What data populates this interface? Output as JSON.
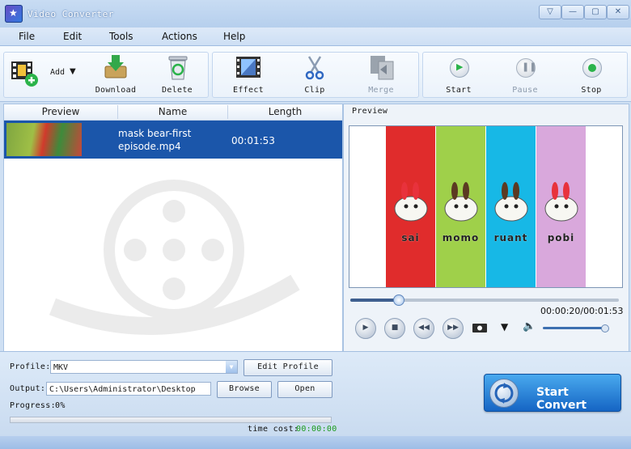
{
  "window": {
    "title": "Video Converter"
  },
  "menu": [
    "File",
    "Edit",
    "Tools",
    "Actions",
    "Help"
  ],
  "toolbar": {
    "add": "Add",
    "download": "Download",
    "delete": "Delete",
    "effect": "Effect",
    "clip": "Clip",
    "merge": "Merge",
    "start": "Start",
    "pause": "Pause",
    "stop": "Stop"
  },
  "file_list": {
    "columns": [
      "Preview",
      "Name",
      "Length"
    ],
    "rows": [
      {
        "name_line1": "mask bear-first",
        "name_line2": "episode.mp4",
        "length": "00:01:53"
      }
    ]
  },
  "preview": {
    "title": "Preview",
    "characters": [
      "sai",
      "momo",
      "ruant",
      "pobi"
    ],
    "stripe_colors": [
      "#e02c2c",
      "#9fd04a",
      "#17b8e6",
      "#d9a8dc"
    ],
    "timecode": "00:00:20/00:01:53",
    "position_fraction": 0.177,
    "volume_fraction": 1.0
  },
  "output": {
    "profile_label": "Profile:",
    "profile_value": "MKV",
    "edit_profile": "Edit Profile",
    "output_label": "Output:",
    "output_path": "C:\\Users\\Administrator\\Desktop",
    "browse": "Browse",
    "open": "Open",
    "progress_label": "Progress:",
    "progress_value": "0%",
    "progress_fraction": 0,
    "time_cost_label": "time cost:",
    "time_cost_value": "00:00:00",
    "start_convert": "Start Convert"
  },
  "colors": {
    "selection": "#1b56aa",
    "accent": "#1565c4",
    "time_cost": "#1a9a1a"
  }
}
